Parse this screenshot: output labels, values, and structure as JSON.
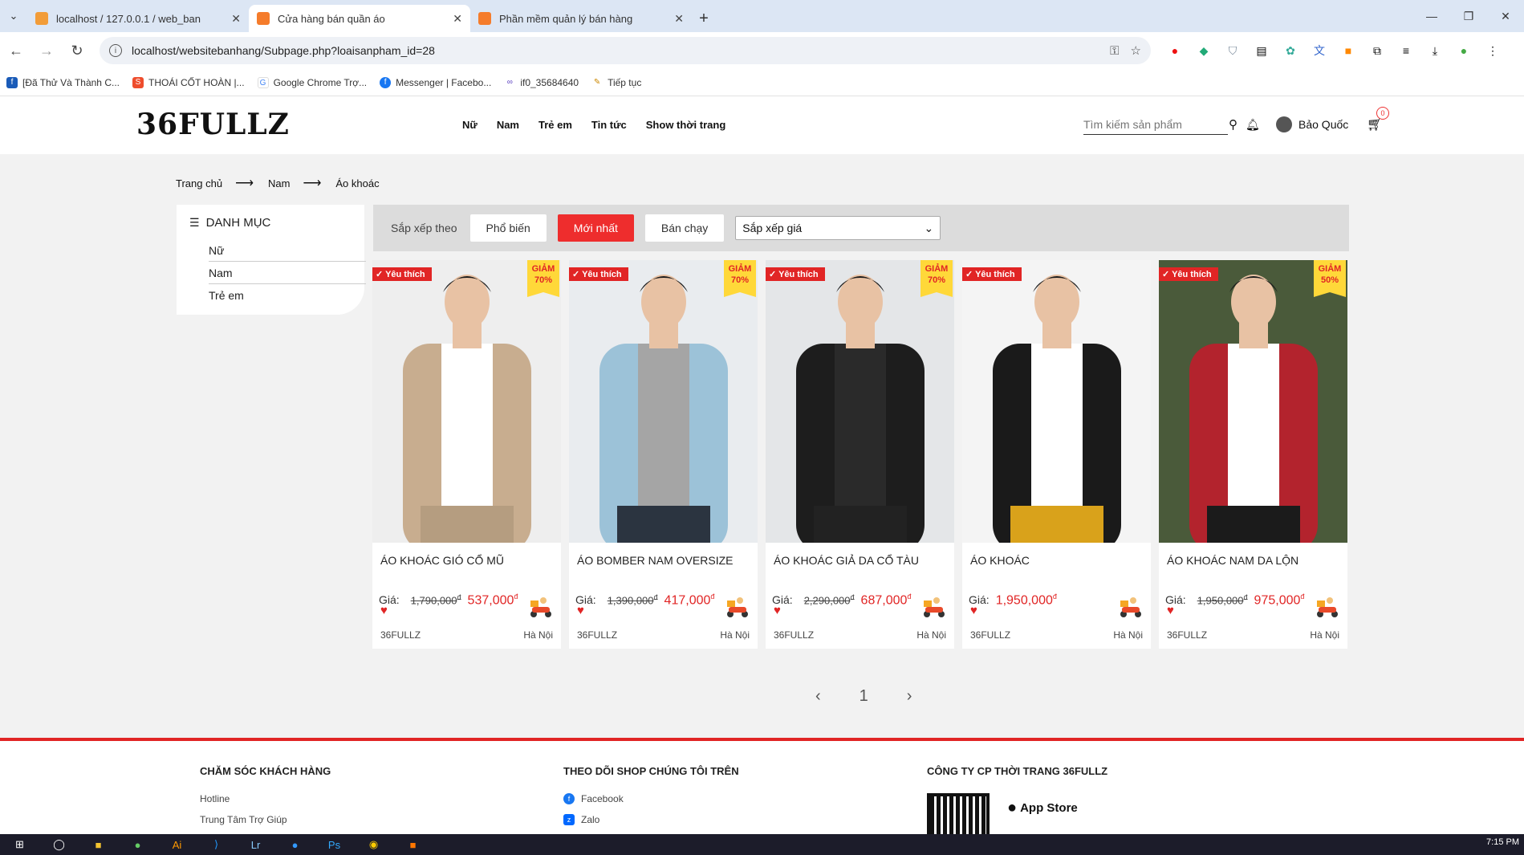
{
  "browser": {
    "tabs": [
      {
        "title": "localhost / 127.0.0.1 / web_ban",
        "active": false
      },
      {
        "title": "Cửa hàng bán quần áo",
        "active": true
      },
      {
        "title": "Phần mềm quản lý bán hàng",
        "active": false
      }
    ],
    "url": "localhost/websitebanhang/Subpage.php?loaisanpham_id=28",
    "bookmarks": [
      "[Đã Thử Và Thành C...",
      "THOÁI CỐT HOÀN |...",
      "Google Chrome Trợ...",
      "Messenger | Facebo...",
      "if0_35684640",
      "Tiếp tục"
    ]
  },
  "header": {
    "logo": "36FULLZ",
    "nav": [
      "Nữ",
      "Nam",
      "Trẻ em",
      "Tin tức",
      "Show thời trang"
    ],
    "search_placeholder": "Tìm kiếm sản phẩm",
    "user_name": "Bảo Quốc",
    "cart_count": "0"
  },
  "breadcrumb": [
    "Trang chủ",
    "Nam",
    "Áo khoác"
  ],
  "sidebar": {
    "title": "DANH MỤC",
    "items": [
      "Nữ",
      "Nam",
      "Trẻ em"
    ]
  },
  "sortbar": {
    "label": "Sắp xếp theo",
    "buttons": [
      "Phổ biến",
      "Mới nhất",
      "Bán chạy"
    ],
    "active": "Mới nhất",
    "select_value": "Sắp xếp giá"
  },
  "products": [
    {
      "name": "ÁO KHOÁC GIÓ CỔ MŨ",
      "price_label": "Giá:",
      "old_price": "1,790,000",
      "new_price": "537,000",
      "currency": "đ",
      "fav": "Yêu thích",
      "sale": [
        "GIẢM",
        "70%"
      ],
      "brand": "36FULLZ",
      "location": "Hà Nội",
      "colors": {
        "bg": "#eeeeee",
        "jacket": "#c8ad8f",
        "inner": "#ffffff",
        "pants": "#b59d80"
      }
    },
    {
      "name": "ÁO BOMBER NAM OVERSIZE",
      "price_label": "Giá:",
      "old_price": "1,390,000",
      "new_price": "417,000",
      "currency": "đ",
      "fav": "Yêu thích",
      "sale": [
        "GIẢM",
        "70%"
      ],
      "brand": "36FULLZ",
      "location": "Hà Nội",
      "colors": {
        "bg": "#e9ecef",
        "jacket": "#9cc2d8",
        "inner": "#a5a5a5",
        "pants": "#2b3440"
      }
    },
    {
      "name": "ÁO KHOÁC GIẢ DA CỔ TÀU",
      "price_label": "Giá:",
      "old_price": "2,290,000",
      "new_price": "687,000",
      "currency": "đ",
      "fav": "Yêu thích",
      "sale": [
        "GIẢM",
        "70%"
      ],
      "brand": "36FULLZ",
      "location": "Hà Nội",
      "colors": {
        "bg": "#e4e6e8",
        "jacket": "#1d1d1d",
        "inner": "#2a2a2a",
        "pants": "#222222"
      }
    },
    {
      "name": "ÁO KHOÁC",
      "price_label": "Giá:",
      "old_price": "",
      "new_price": "1,950,000",
      "currency": "đ",
      "fav": "Yêu thích",
      "sale": [],
      "brand": "36FULLZ",
      "location": "Hà Nội",
      "colors": {
        "bg": "#f4f4f4",
        "jacket": "#1a1a1a",
        "inner": "#ffffff",
        "pants": "#d9a21b"
      }
    },
    {
      "name": "ÁO KHOÁC NAM DA LỘN",
      "price_label": "Giá:",
      "old_price": "1,950,000",
      "new_price": "975,000",
      "currency": "đ",
      "fav": "Yêu thích",
      "sale": [
        "GIẢM",
        "50%"
      ],
      "brand": "36FULLZ",
      "location": "Hà Nội",
      "colors": {
        "bg": "#4a5a3a",
        "jacket": "#b3232d",
        "inner": "#ffffff",
        "pants": "#1b1b1b"
      }
    }
  ],
  "pagination": {
    "prev": "‹",
    "page": "1",
    "next": "›"
  },
  "footer": {
    "col1": {
      "title": "CHĂM SÓC KHÁCH HÀNG",
      "items": [
        "Hotline",
        "Trung Tâm Trợ Giúp"
      ]
    },
    "col2": {
      "title": "THEO DÕI SHOP CHÚNG TÔI TRÊN",
      "items": [
        "Facebook",
        "Zalo"
      ]
    },
    "col3": {
      "title": "CÔNG TY CP THỜI TRANG 36FULLZ",
      "appstore": "App Store"
    }
  },
  "taskbar": {
    "time": "7:15 PM"
  }
}
